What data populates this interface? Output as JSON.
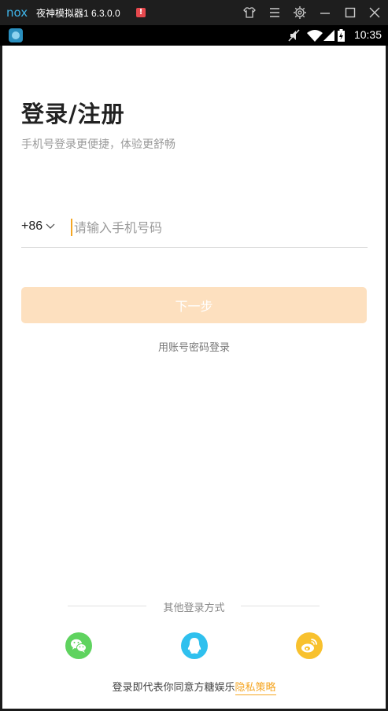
{
  "window": {
    "title": "夜神模拟器1 6.3.0.0",
    "warn_badge": "!"
  },
  "statusbar": {
    "time": "10:35"
  },
  "login": {
    "title": "登录/注册",
    "subtitle": "手机号登录更便捷，体验更舒畅",
    "country_code": "+86",
    "phone_placeholder": "请输入手机号码",
    "phone_value": "",
    "next_label": "下一步",
    "account_login_label": "用账号密码登录",
    "other_methods_title": "其他登录方式",
    "agreement_prefix": "登录即代表你同意方糖娱乐",
    "privacy_label": "隐私策略"
  },
  "colors": {
    "accent": "#f5a623",
    "button_disabled": "#fde0bf",
    "wechat": "#5fd35f",
    "qq": "#2fc0ee",
    "weibo": "#f8c12e"
  },
  "icons": {
    "social": [
      "wechat-icon",
      "qq-icon",
      "weibo-icon"
    ]
  }
}
